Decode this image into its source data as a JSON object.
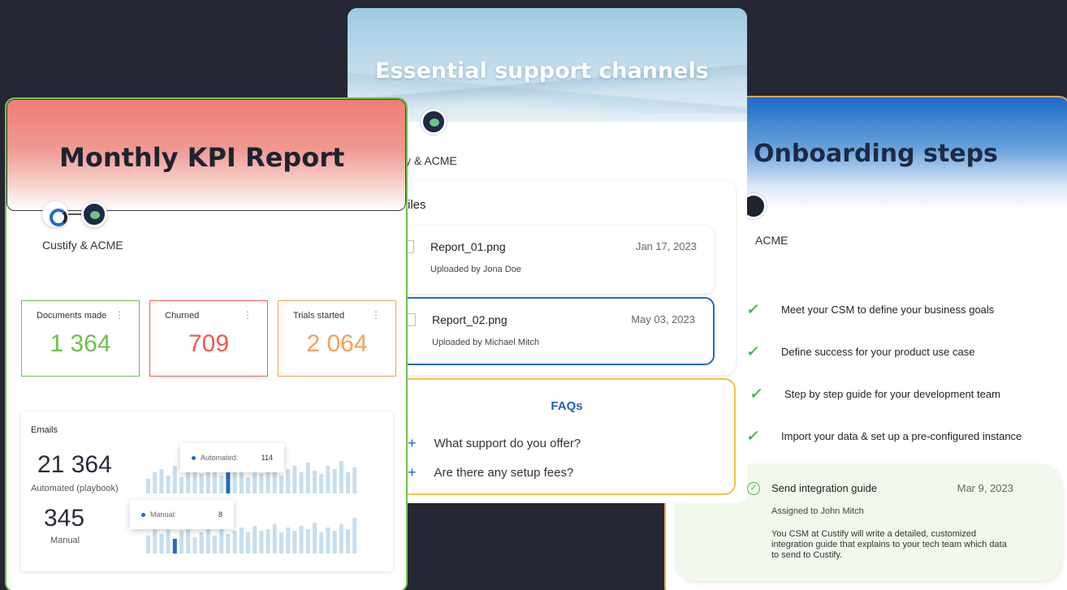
{
  "onboarding": {
    "title": "Onboarding steps",
    "owners": "ACME",
    "steps": [
      "Meet your CSM to define your business goals",
      "Define success for your product use case",
      "Step by step guide for your development team",
      "Import your data & set up a pre-configured instance"
    ],
    "task": {
      "title": "Send integration guide",
      "date": "Mar 9, 2023",
      "assignee": "Assigned to John Mitch",
      "description": "You CSM at Custify will write a detailed, customized integration guide that explains to your tech team which data to send to Custify."
    }
  },
  "support": {
    "title": "Essential support channels",
    "owners": "ify & ACME",
    "files_title": "iles",
    "files": [
      {
        "name": "Report_01.png",
        "date": "Jan 17, 2023",
        "uploaded": "Uploaded by Jona Doe"
      },
      {
        "name": "Report_02.png",
        "date": "May 03, 2023",
        "uploaded": "Uploaded by Michael Mitch"
      }
    ],
    "faq_title": "FAQs",
    "faqs": [
      "What support do you offer?",
      "Are there any setup fees?"
    ]
  },
  "kpi": {
    "title": "Monthly KPI Report",
    "owners": "Custify & ACME",
    "cards": [
      {
        "label": "Documents made",
        "value": "1 364",
        "color": "#6cc04a"
      },
      {
        "label": "Churned",
        "value": "709",
        "color": "#ee5a4a"
      },
      {
        "label": "Trials started",
        "value": "2 064",
        "color": "#f4a05a"
      }
    ],
    "emails": {
      "title": "Emails",
      "automated_value": "21 364",
      "automated_label": "Automated (playbook)",
      "manual_value": "345",
      "manual_label": "Manual",
      "tooltip_automated": {
        "label": "Automated:",
        "value": "114"
      },
      "tooltip_manual": {
        "label": "Manual:",
        "value": "8"
      }
    },
    "colors": {
      "bar": "#c6def0",
      "bar_active": "#1f6bc6"
    }
  }
}
